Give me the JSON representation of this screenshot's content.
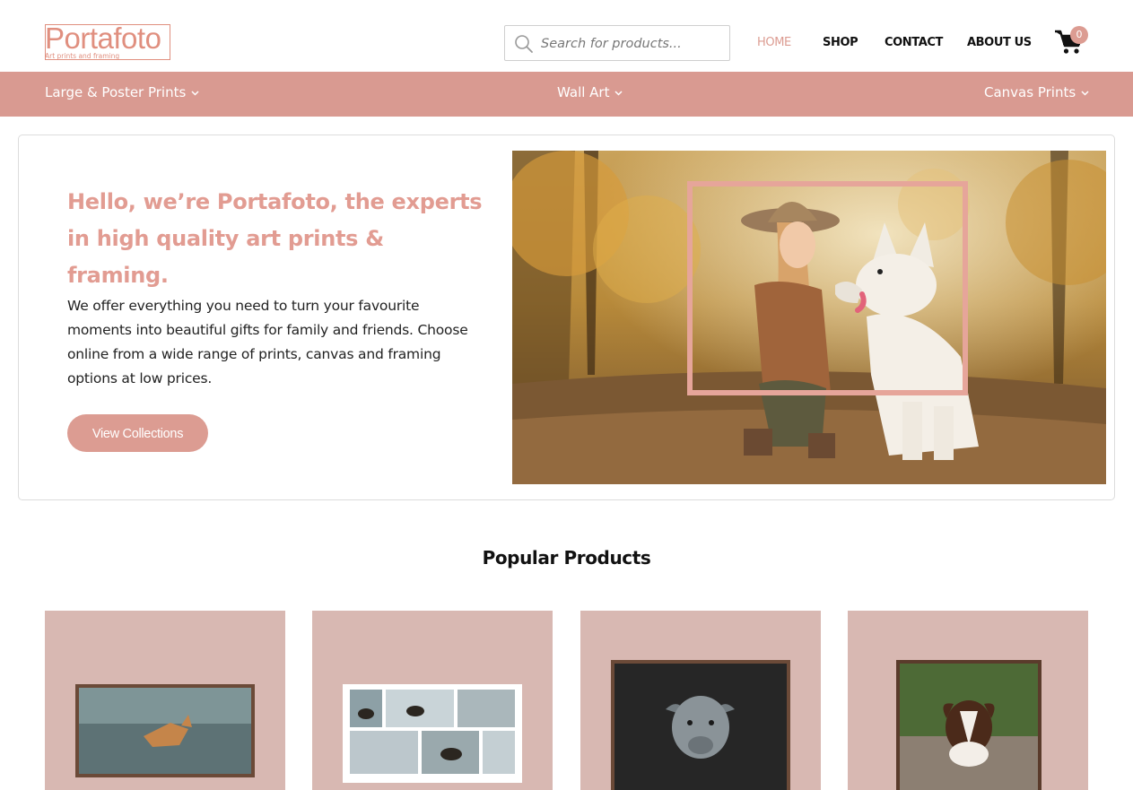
{
  "header": {
    "logo": {
      "wordmark": "Portafoto",
      "tagline": "Art prints and framing"
    },
    "search": {
      "placeholder": "Search for products..."
    },
    "nav": [
      "HOME",
      "SHOP",
      "CONTACT",
      "ABOUT US"
    ],
    "active_nav": "HOME",
    "cart_count": "0"
  },
  "category_bar": {
    "items": [
      "Large & Poster Prints",
      "Wall Art",
      "Canvas Prints"
    ]
  },
  "hero": {
    "title": "Hello, we’re Portafoto, the experts in high quality art prints & framing.",
    "body": "We offer everything you need to turn your favourite moments into beautiful gifts for family and friends. Choose online from a wide range of prints, canvas and framing options at low prices.",
    "button": "View Collections"
  },
  "popular": {
    "title": "Popular Products"
  },
  "colors": {
    "brand": "#d99a91",
    "accent": "#dc9c92",
    "card_bg": "#d8b8b2"
  }
}
